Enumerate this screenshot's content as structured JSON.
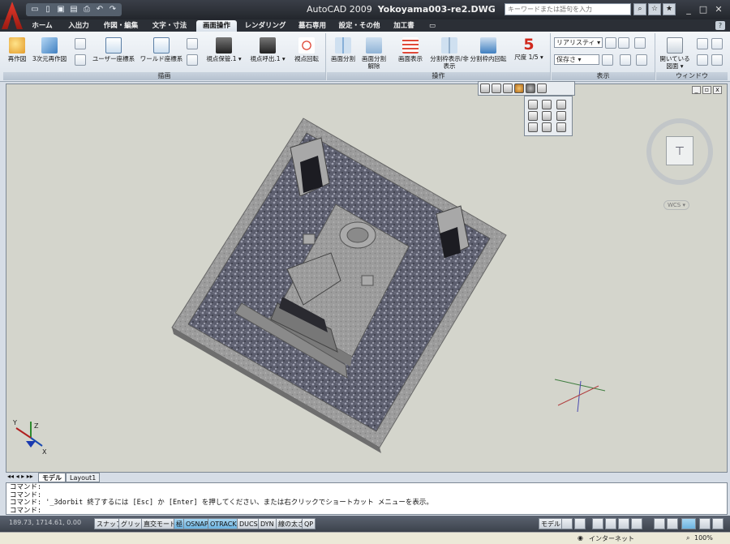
{
  "titlebar": {
    "app_name": "AutoCAD 2009",
    "file_name": "Yokoyama003-re2.DWG",
    "search_placeholder": "キーワードまたは語句を入力"
  },
  "tabs": [
    {
      "label": "ホーム"
    },
    {
      "label": "入出力"
    },
    {
      "label": "作図・編集"
    },
    {
      "label": "文字・寸法"
    },
    {
      "label": "画面操作",
      "active": true
    },
    {
      "label": "レンダリング"
    },
    {
      "label": "墓石専用"
    },
    {
      "label": "設定・その他"
    },
    {
      "label": "加工書"
    }
  ],
  "ribbon": {
    "draw_panel": {
      "title": "描画",
      "regen": "再作図",
      "regen3d": "3次元再作図",
      "ucs": "ユーザー座標系",
      "wcs": "ワールド座標系",
      "view_save": "視点保管.1",
      "view_call": "視点呼出.1",
      "view_rotate": "視点回転"
    },
    "ops_panel": {
      "title": "操作",
      "split": "画面分割",
      "split_off": "画面分割解除",
      "display": "画面表示",
      "frame_toggle": "分割枠表示/非表示",
      "frame_rotate": "分割枠内回転",
      "scale_number": "5",
      "scale_label": "尺度 1/5"
    },
    "display_panel": {
      "title": "表示",
      "visual_style": "リアリスティ",
      "saved_view": "保存さ"
    },
    "window_panel": {
      "title": "ウィンドウ",
      "open_drawings": "開いている図面"
    }
  },
  "viewport": {
    "wcs_label": "WCS",
    "ucs_z": "Z",
    "ucs_y": "Y",
    "ucs_x": "X"
  },
  "layout_tabs": [
    {
      "label": "モデル",
      "active": true
    },
    {
      "label": "Layout1"
    }
  ],
  "command_lines": [
    "コマンド:",
    "コマンド:",
    "コマンド: '_3dorbit 終了するには [Esc] か [Enter] を押してください、または右クリックでショートカット メニューを表示。",
    "コマンド:"
  ],
  "status": {
    "coordinates": "189.73, 1714.61, 0.00",
    "buttons": [
      {
        "label": "スナップ",
        "on": false
      },
      {
        "label": "グリッド",
        "on": false
      },
      {
        "label": "直交モード",
        "on": false
      },
      {
        "label": "極",
        "on": true
      },
      {
        "label": "OSNAP",
        "on": true
      },
      {
        "label": "OTRACK",
        "on": true
      },
      {
        "label": "DUCS",
        "on": false
      },
      {
        "label": "DYN",
        "on": false
      },
      {
        "label": "線の太さ",
        "on": false
      },
      {
        "label": "QP",
        "on": false
      }
    ],
    "model_label": "モデル"
  },
  "browser": {
    "zone": "インターネット",
    "zoom": "100%"
  },
  "colors": {
    "titlebar": "#2b2f36",
    "viewport_bg": "#d4d5cc",
    "granite_dark": "#5c5e6e",
    "stone": "#9a9a9a",
    "accent_red": "#d0281c",
    "status_on": "#6cb3e0"
  }
}
